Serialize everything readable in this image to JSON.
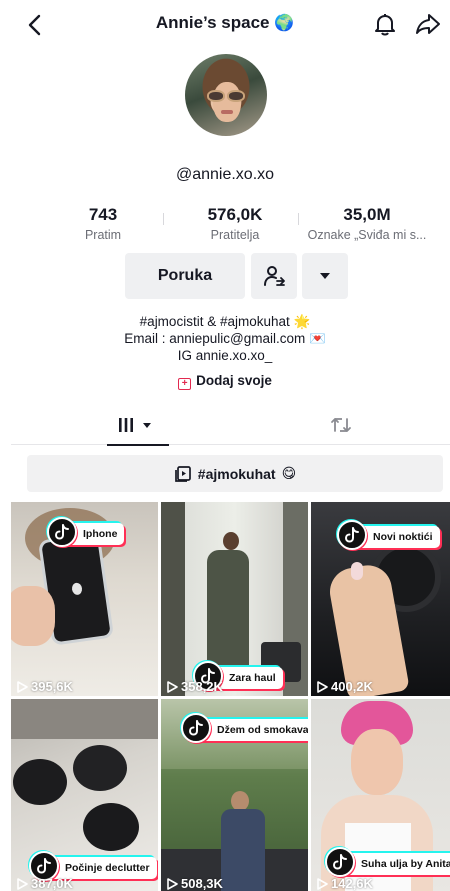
{
  "header": {
    "title": "Annie’s space",
    "title_emoji": "🌍"
  },
  "profile": {
    "username": "@annie.xo.xo",
    "stats": [
      {
        "value": "743",
        "label": "Pratim"
      },
      {
        "value": "576,0K",
        "label": "Pratitelja"
      },
      {
        "value": "35,0M",
        "label": "Oznake „Sviđa mi s..."
      }
    ],
    "message_button": "Poruka",
    "bio": [
      "#ajmocistit & #ajmokuhat 🌟",
      "Email : anniepulic@gmail.com 💌",
      "IG annie.xo.xo_"
    ],
    "add_link": "Dodaj svoje"
  },
  "playlist": {
    "label": "#ajmokuhat",
    "emoji": "😋"
  },
  "videos": [
    {
      "views": "395,6K",
      "tag": "Iphone"
    },
    {
      "views": "358,2K",
      "tag": "Zara haul"
    },
    {
      "views": "400,2K",
      "tag": "Novi noktići"
    },
    {
      "views": "387,0K",
      "tag": "Počinje declutter"
    },
    {
      "views": "508,3K",
      "tag": "Džem od smokava"
    },
    {
      "views": "142,6K",
      "tag": "Suha ulja by Anita"
    }
  ],
  "colors": {
    "accent": "#fe2c55",
    "text": "#161823",
    "secondary": "#6b6d75",
    "button_bg": "#eff0f2"
  },
  "icons": {
    "back": "chevron-left-icon",
    "bell": "bell-icon",
    "share": "share-icon",
    "friend": "add-friend-icon",
    "more": "caret-down-icon",
    "grid": "grid-icon",
    "repost": "repost-icon",
    "playlist": "playlist-icon",
    "play": "play-icon",
    "tiktok": "tiktok-logo-icon"
  }
}
